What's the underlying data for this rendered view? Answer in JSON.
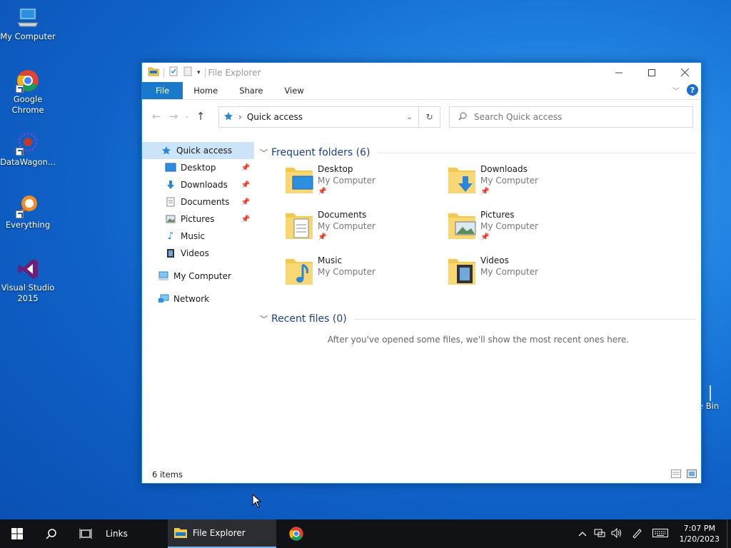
{
  "desktop": {
    "icons": [
      {
        "label": "My Computer"
      },
      {
        "label": "Google Chrome"
      },
      {
        "label": "DataWagon..."
      },
      {
        "label": "Everything"
      },
      {
        "label": "Visual Studio 2015"
      }
    ],
    "partial_label": "e Bin"
  },
  "window": {
    "title": "File Explorer",
    "ribbon_tabs": [
      "File",
      "Home",
      "Share",
      "View"
    ],
    "help_label": "?",
    "address": {
      "path": "Quick access",
      "breadcrumb_sep": "›"
    },
    "search": {
      "placeholder": "Search Quick access"
    },
    "nav": {
      "quick_access": "Quick access",
      "items": [
        {
          "label": "Desktop",
          "pinned": true
        },
        {
          "label": "Downloads",
          "pinned": true
        },
        {
          "label": "Documents",
          "pinned": true
        },
        {
          "label": "Pictures",
          "pinned": true
        },
        {
          "label": "Music",
          "pinned": false
        },
        {
          "label": "Videos",
          "pinned": false
        }
      ],
      "my_computer": "My Computer",
      "network": "Network"
    },
    "frequent": {
      "header": "Frequent folders (6)",
      "folders": [
        {
          "name": "Desktop",
          "location": "My Computer",
          "pinned": true
        },
        {
          "name": "Downloads",
          "location": "My Computer",
          "pinned": true
        },
        {
          "name": "Documents",
          "location": "My Computer",
          "pinned": true
        },
        {
          "name": "Pictures",
          "location": "My Computer",
          "pinned": true
        },
        {
          "name": "Music",
          "location": "My Computer",
          "pinned": false
        },
        {
          "name": "Videos",
          "location": "My Computer",
          "pinned": false
        }
      ]
    },
    "recent": {
      "header": "Recent files (0)",
      "empty_message": "After you've opened some files, we'll show the most recent ones here."
    },
    "status": {
      "item_count": "6 items"
    }
  },
  "taskbar": {
    "links_label": "Links",
    "active_app": "File Explorer",
    "clock": {
      "time": "7:07 PM",
      "date": "1/20/2023"
    }
  },
  "colors": {
    "accent": "#1979ca",
    "selection": "#cce4f7",
    "header_text": "#1e3e8a",
    "folder": "#f2c94c"
  }
}
